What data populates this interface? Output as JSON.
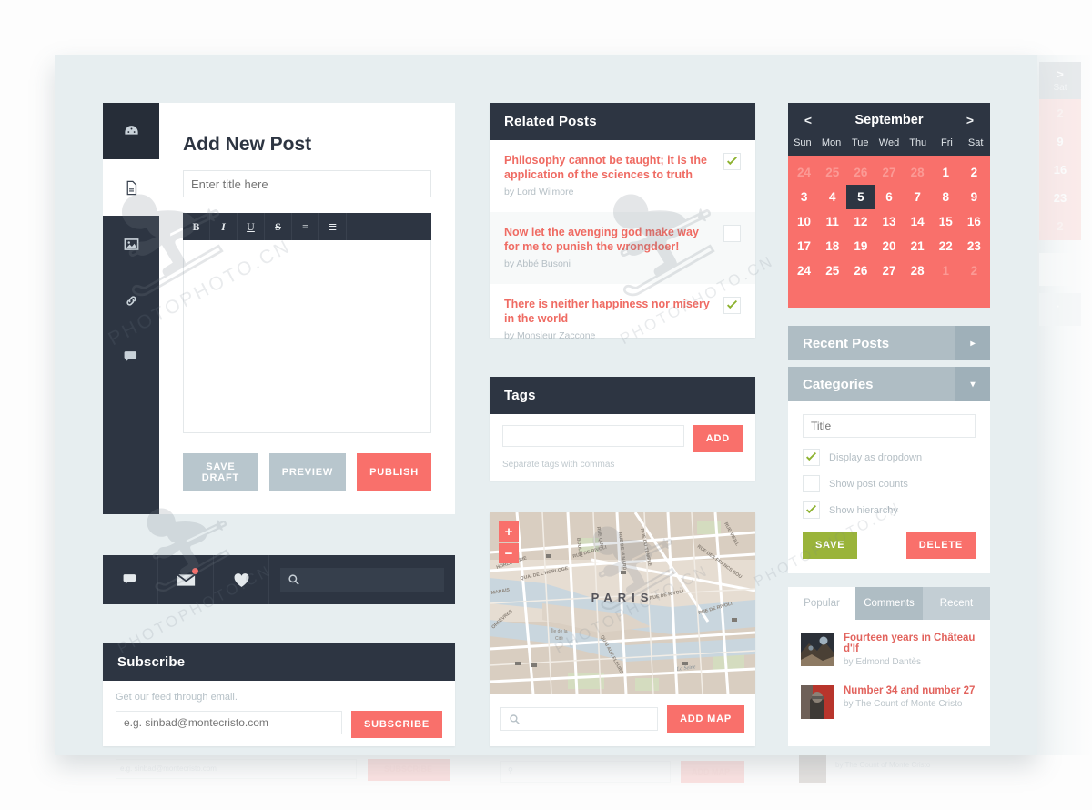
{
  "editor": {
    "sidebar_icons": [
      "dashboard-icon",
      "document-icon",
      "image-icon",
      "link-icon",
      "comment-icon"
    ],
    "title": "Add New Post",
    "title_input_placeholder": "Enter title here",
    "title_input_value": "",
    "toolbar": [
      "B",
      "I",
      "U",
      "S",
      "≡",
      "≣"
    ],
    "toolbar_names": [
      "bold",
      "italic",
      "underline",
      "strikethrough",
      "unordered-list",
      "ordered-list"
    ],
    "save_draft_label": "SAVE DRAFT",
    "preview_label": "PREVIEW",
    "publish_label": "PUBLISH"
  },
  "social": {
    "icons": [
      "comment-icon",
      "envelope-icon",
      "heart-icon"
    ],
    "has_notification": true,
    "search_placeholder": "",
    "search_value": ""
  },
  "subscribe": {
    "heading": "Subscribe",
    "note": "Get our feed through email.",
    "input_placeholder": "e.g. sinbad@montecristo.com",
    "input_value": "",
    "button_label": "SUBSCRIBE"
  },
  "related_posts": {
    "heading": "Related Posts",
    "items": [
      {
        "title": "Philosophy cannot be taught; it is the application of the sciences to truth",
        "by": "by Lord Wilmore",
        "checked": true
      },
      {
        "title": "Now let the avenging god make way for me to punish the wrongdoer!",
        "by": "by Abbé Busoni",
        "checked": false
      },
      {
        "title": "There is neither happiness nor misery in the world",
        "by": "by Monsieur Zaccone",
        "checked": true
      }
    ]
  },
  "tags": {
    "heading": "Tags",
    "input_placeholder": "",
    "input_value": "",
    "add_label": "ADD",
    "note": "Separate tags with commas"
  },
  "map": {
    "city_label": "PARIS",
    "zoom_in": "+",
    "zoom_out": "−",
    "search_placeholder": "",
    "search_value": "",
    "add_label": "ADD MAP",
    "street_labels": [
      "RUE QUI",
      "RUE DU TEMPLE",
      "RUE SAINT MARTIN",
      "RUE DES FRANCS BOU",
      "RUE VIEILL",
      "RUE DE RIVOLI",
      "RUE DE RIVOLI",
      "RUE DE RIVOLI",
      "QUAI DE L'HORLOGE",
      "MARAIS",
      "ORFÈVRES",
      "Île de la Cité",
      "QUAI AUX FLEURS",
      "La Seine",
      "BOULEV"
    ]
  },
  "calendar": {
    "prev_label": "<",
    "month": "September",
    "next_label": ">",
    "dow": [
      "Sun",
      "Mon",
      "Tue",
      "Wed",
      "Thu",
      "Fri",
      "Sat"
    ],
    "cells": [
      {
        "d": "24",
        "mut": true
      },
      {
        "d": "25",
        "mut": true
      },
      {
        "d": "26",
        "mut": true
      },
      {
        "d": "27",
        "mut": true
      },
      {
        "d": "28",
        "mut": true
      },
      {
        "d": "1"
      },
      {
        "d": "2"
      },
      {
        "d": "3"
      },
      {
        "d": "4"
      },
      {
        "d": "5",
        "sel": true
      },
      {
        "d": "6"
      },
      {
        "d": "7"
      },
      {
        "d": "8"
      },
      {
        "d": "9"
      },
      {
        "d": "10"
      },
      {
        "d": "11"
      },
      {
        "d": "12"
      },
      {
        "d": "13"
      },
      {
        "d": "14"
      },
      {
        "d": "15"
      },
      {
        "d": "16"
      },
      {
        "d": "17"
      },
      {
        "d": "18"
      },
      {
        "d": "19"
      },
      {
        "d": "20"
      },
      {
        "d": "21"
      },
      {
        "d": "22"
      },
      {
        "d": "23"
      },
      {
        "d": "24"
      },
      {
        "d": "25"
      },
      {
        "d": "26"
      },
      {
        "d": "27"
      },
      {
        "d": "28"
      },
      {
        "d": "1",
        "mut": true
      },
      {
        "d": "2",
        "mut": true
      }
    ]
  },
  "recent_posts": {
    "heading": "Recent Posts",
    "caret": "▸"
  },
  "categories": {
    "heading": "Categories",
    "caret": "▾",
    "title_placeholder": "Title",
    "title_value": "",
    "options": [
      {
        "label": "Display as dropdown",
        "checked": true
      },
      {
        "label": "Show post counts",
        "checked": false
      },
      {
        "label": "Show hierarchy",
        "checked": true
      }
    ],
    "save_label": "SAVE",
    "delete_label": "DELETE"
  },
  "tabs_widget": {
    "tabs": [
      {
        "label": "Popular",
        "state": "inactive"
      },
      {
        "label": "Comments",
        "state": "active"
      },
      {
        "label": "Recent",
        "state": "third"
      }
    ],
    "items": [
      {
        "title": "Fourteen years in Château d'If",
        "by": "by Edmond Dantès"
      },
      {
        "title": "Number 34 and number 27",
        "by": "by The Count of Monte Cristo"
      }
    ]
  },
  "edge_preview": {
    "next_label": ">",
    "dow": "Sat",
    "days": [
      {
        "d": "2",
        "mut": true
      },
      {
        "d": "9"
      },
      {
        "d": "16"
      },
      {
        "d": "23"
      },
      {
        "d": "2",
        "mut": true
      }
    ]
  },
  "watermark": {
    "text": "PHOTOPHOTO.CN"
  },
  "colors": {
    "dark": "#2d3542",
    "accent_red": "#f9706b",
    "muted_blue": "#b8c6cd",
    "panel_blue": "#afbdc4",
    "green": "#9ab43a",
    "check_green": "#8db22f",
    "desk_bg": "#e7eef0"
  }
}
